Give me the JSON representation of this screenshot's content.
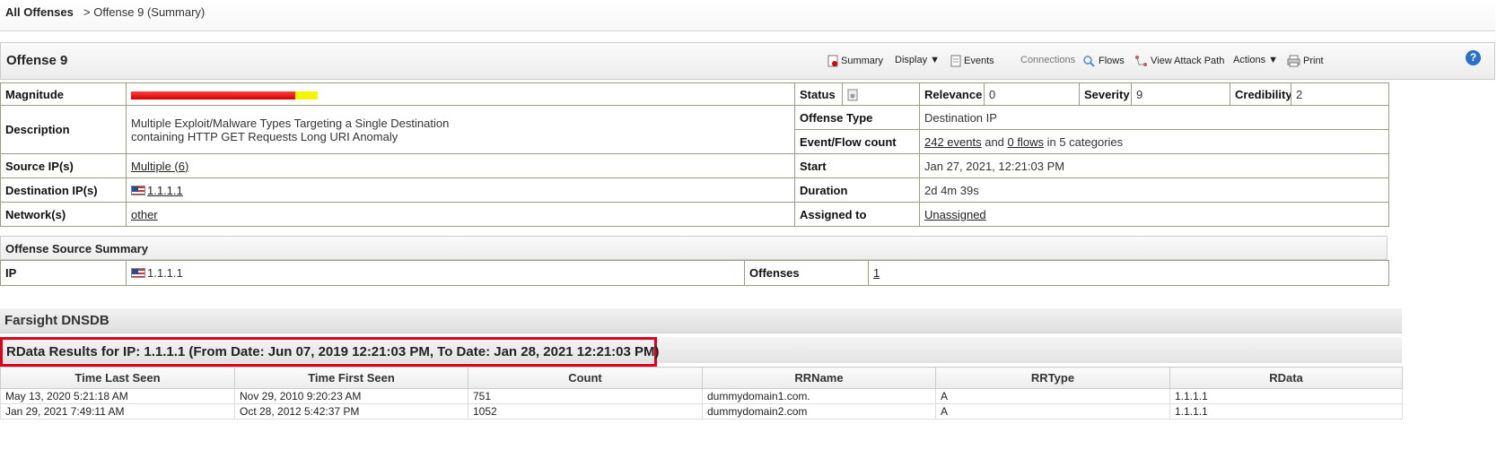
{
  "breadcrumb": {
    "root": "All Offenses",
    "current": "> Offense 9 (Summary)"
  },
  "offense": {
    "title": "Offense 9",
    "toolbar": {
      "summary": "Summary",
      "display": "Display ▼",
      "events": "Events",
      "connections": "Connections",
      "flows": "Flows",
      "attack_path": "View Attack Path",
      "actions": "Actions ▼",
      "print": "Print",
      "help": "?"
    }
  },
  "details": {
    "magnitude_label": "Magnitude",
    "magnitude": {
      "red_fraction": 0.88,
      "colors": {
        "red": "#e00000",
        "yellow": "#f5f500"
      }
    },
    "status_label": "Status",
    "relevance_label": "Relevance",
    "relevance": "0",
    "severity_label": "Severity",
    "severity": "9",
    "credibility_label": "Credibility",
    "credibility": "2",
    "description_label": "Description",
    "description_line1": "Multiple Exploit/Malware Types Targeting a Single Destination",
    "description_line2": "containing HTTP GET Requests Long URI Anomaly",
    "offense_type_label": "Offense Type",
    "offense_type": "Destination IP",
    "event_flow_label": "Event/Flow count",
    "events_link": "242 events",
    "and_text": " and ",
    "flows_link": "0 flows",
    "categories_text": " in 5 categories",
    "source_ips_label": "Source IP(s)",
    "source_ips": "Multiple (6)",
    "start_label": "Start",
    "start": "Jan 27, 2021, 12:21:03 PM",
    "dest_ips_label": "Destination IP(s)",
    "dest_ip": "1.1.1.1",
    "duration_label": "Duration",
    "duration": "2d 4m 39s",
    "networks_label": "Network(s)",
    "network": "other",
    "assigned_label": "Assigned to",
    "assigned": "Unassigned"
  },
  "source_summary": {
    "title": "Offense Source Summary",
    "ip_label": "IP",
    "ip": "1.1.1.1",
    "offenses_label": "Offenses",
    "offenses": "1"
  },
  "farsight": {
    "title": "Farsight DNSDB",
    "rdata_title": "RData Results for IP: 1.1.1.1 (From Date: Jun 07, 2019 12:21:03 PM, To Date: Jan 28, 2021 12:21:03 PM)",
    "columns": [
      "Time Last Seen",
      "Time First Seen",
      "Count",
      "RRName",
      "RRType",
      "RData"
    ],
    "rows": [
      [
        "May 13, 2020 5:21:18 AM",
        "Nov 29, 2010 9:20:23 AM",
        "751",
        "dummydomain1.com.",
        "A",
        "1.1.1.1"
      ],
      [
        "Jan 29, 2021 7:49:11 AM",
        "Oct 28, 2012 5:42:37 PM",
        "1052",
        "dummydomain2.com",
        "A",
        "1.1.1.1"
      ]
    ]
  }
}
